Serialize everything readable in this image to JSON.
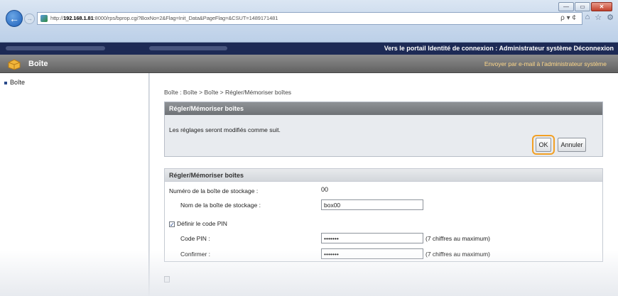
{
  "window": {
    "min": "—",
    "max": "▭",
    "close": "✕"
  },
  "browser": {
    "url_prefix": "http://",
    "url_host": "192.168.1.81",
    "url_rest": ":8000/rps/bprop.cgi?BoxNo=2&Flag=Init_Data&PageFlag=&CSUT=1489171481",
    "addr_tools": "ρ ▾ ¢",
    "tools": [
      "⌂",
      "☆",
      "⚙"
    ]
  },
  "header": {
    "top_links": "Vers le portail  Identité de connexion : Administrateur système  Déconnexion",
    "app_title": "Boîte",
    "mail_link": "Envoyer par e-mail à l'administrateur système"
  },
  "sidebar": {
    "items": [
      {
        "label": "Boîte"
      }
    ]
  },
  "main": {
    "breadcrumb": "Boîte : Boîte > Boîte > Régler/Mémoriser boîtes",
    "panel1": {
      "title": "Régler/Mémoriser boîtes",
      "message": "Les réglages seront modifiés comme suit.",
      "ok_label": "OK",
      "cancel_label": "Annuler"
    },
    "panel2": {
      "title": "Régler/Mémoriser boîtes",
      "box_number_label": "Numéro de la boîte de stockage :",
      "box_number_value": "00",
      "box_name_label": "Nom de la boîte de stockage :",
      "box_name_value": "box00",
      "pin_checkbox_label": "Définir le code PIN",
      "pin_checked_mark": "✓",
      "pin_label": "Code PIN :",
      "pin_value": "•••••••",
      "pin_note": "(7 chiffres au maximum)",
      "confirm_label": "Confirmer :",
      "confirm_value": "•••••••",
      "confirm_note": "(7 chiffres au maximum)"
    }
  }
}
